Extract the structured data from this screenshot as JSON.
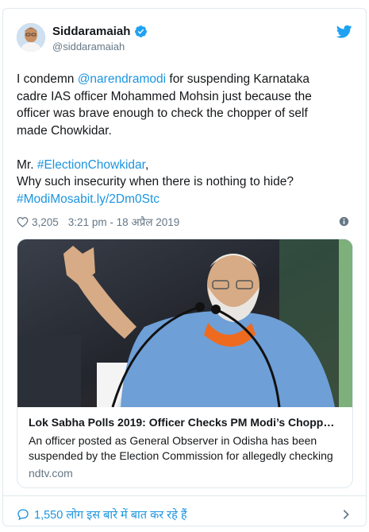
{
  "tweet": {
    "author_name": "Siddaramaiah",
    "author_handle": "@siddaramaiah",
    "text_segments": [
      {
        "text": "I condemn ",
        "link": false
      },
      {
        "text": "@narendramodi",
        "link": true
      },
      {
        "text": " for suspending Karnataka\ncadre IAS officer Mohammed Mohsin just because the\nofficer was brave enough to check the chopper of self\nmade Chowkidar.\n\nMr. ",
        "link": false
      },
      {
        "text": "#ElectionChowkidar",
        "link": true
      },
      {
        "text": ",\nWhy such insecurity when there is nothing to hide?\n",
        "link": false
      },
      {
        "text": "#ModiMosa",
        "link": true
      },
      {
        "text": "bit.ly/2Dm0Stc",
        "link": true
      }
    ],
    "like_count": "3,205",
    "timestamp": "3:21 pm - 18 अप्रैल 2019"
  },
  "media_card": {
    "title": "Lok Sabha Polls 2019: Officer Checks PM Modi’s Chopp…",
    "description": "An officer posted as General Observer in Odisha has been suspended by the Election Commission for allegedly checking",
    "domain": "ndtv.com"
  },
  "footer": {
    "talking_text": "1,550 लोग इस बारे में बात कर रहे हैं"
  },
  "icons": {
    "verified": "verified-badge-icon",
    "brand": "twitter-bird-icon",
    "like": "heart-icon",
    "info": "info-icon",
    "comment": "comment-icon",
    "chevron": "chevron-right-icon"
  },
  "colors": {
    "link": "#1b95e0",
    "secondary_text": "#657786",
    "border": "#e1e8ed"
  }
}
